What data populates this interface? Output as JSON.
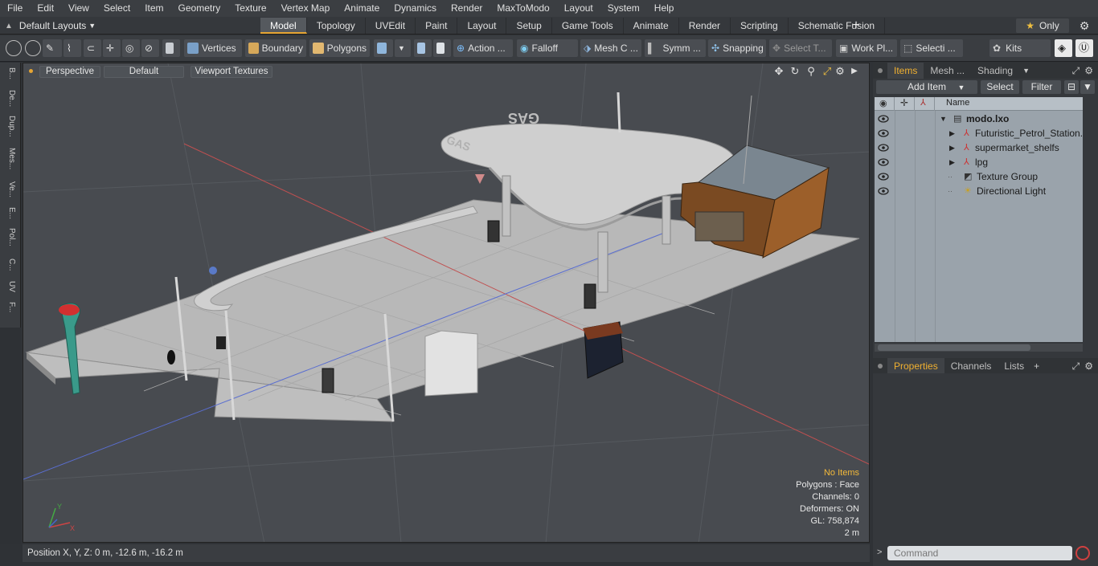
{
  "menu": [
    "File",
    "Edit",
    "View",
    "Select",
    "Item",
    "Geometry",
    "Texture",
    "Vertex Map",
    "Animate",
    "Dynamics",
    "Render",
    "MaxToModo",
    "Layout",
    "System",
    "Help"
  ],
  "layouts_label": "Default Layouts",
  "tabs": [
    "Model",
    "Topology",
    "UVEdit",
    "Paint",
    "Layout",
    "Setup",
    "Game Tools",
    "Animate",
    "Render",
    "Scripting",
    "Schematic Fusion"
  ],
  "only_label": "Only",
  "toolbar": {
    "vertices": "Vertices",
    "boundary": "Boundary",
    "polygons": "Polygons",
    "action": "Action ...",
    "falloff": "Falloff",
    "mesh": "Mesh C ...",
    "symm": "Symm ...",
    "snapping": "Snapping",
    "select_t": "Select T...",
    "work_pl": "Work Pl...",
    "selecti": "Selecti ...",
    "kits": "Kits"
  },
  "left_tabs": [
    "B...",
    "De...",
    "Dup...",
    "Mes...",
    "Ve...",
    "E...",
    "Pol...",
    "C...",
    "UV",
    "F..."
  ],
  "viewport": {
    "perspective": "Perspective",
    "default": "Default",
    "textures": "Viewport Textures",
    "info": {
      "no_items": "No Items",
      "polygons": "Polygons : Face",
      "channels": "Channels: 0",
      "deformers": "Deformers: ON",
      "gl": "GL: 758,874",
      "scale": "2 m"
    },
    "sign_text": "GAS"
  },
  "status": "Position X, Y, Z:   0 m, -12.6 m, -16.2 m",
  "panel": {
    "tabs": [
      "Items",
      "Mesh ...",
      "Shading"
    ],
    "add_item": "Add Item",
    "select": "Select",
    "filter": "Filter",
    "name_col": "Name",
    "items": [
      {
        "label": "modo.lxo"
      },
      {
        "label": "Futuristic_Petrol_Station..."
      },
      {
        "label": "supermarket_shelfs"
      },
      {
        "label": "lpg"
      },
      {
        "label": "Texture Group"
      },
      {
        "label": "Directional Light"
      }
    ],
    "props_tabs": [
      "Properties",
      "Channels",
      "Lists"
    ],
    "command_placeholder": "Command"
  },
  "colors": {
    "accent": "#e6a533",
    "info_yellow": "#f3b93a"
  }
}
